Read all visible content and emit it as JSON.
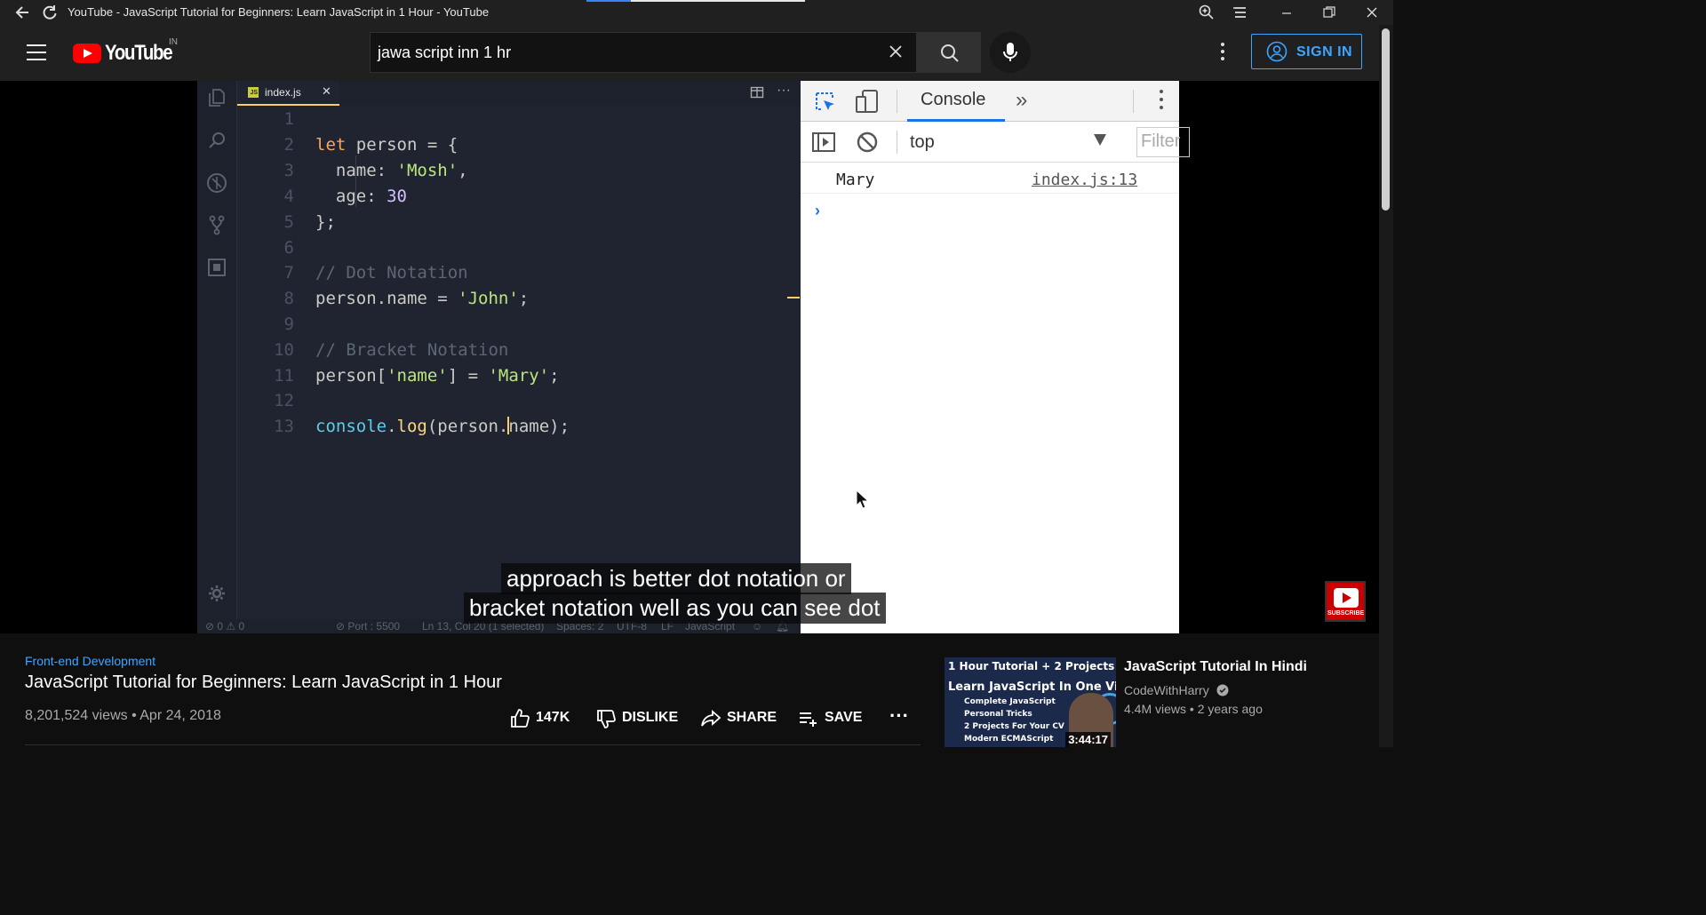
{
  "browser": {
    "page_title": "YouTube - JavaScript Tutorial for Beginners: Learn JavaScript in 1 Hour - YouTube",
    "icons": [
      "back-arrow-icon",
      "reload-icon",
      "zoom-icon",
      "menu-icon",
      "minimize-icon",
      "restore-icon",
      "close-icon"
    ]
  },
  "header": {
    "logo_text": "YouTube",
    "country_code": "IN",
    "search_value": "jawa script inn 1 hr",
    "signin_label": "SIGN IN"
  },
  "video": {
    "editor": {
      "tab_name": "index.js",
      "tab_badge": "JS",
      "line_numbers": [
        "1",
        "2",
        "3",
        "4",
        "5",
        "6",
        "7",
        "8",
        "9",
        "10",
        "11",
        "12",
        "13"
      ],
      "code": {
        "l2_kw": "let",
        "l2_rest": " person = {",
        "l3_key": "  name: ",
        "l3_val": "'Mosh'",
        "l3_end": ",",
        "l4_key": "  age: ",
        "l4_val": "30",
        "l5": "};",
        "l7": "// Dot Notation",
        "l8_a": "person.name = ",
        "l8_val": "'John'",
        "l8_end": ";",
        "l10": "// Bracket Notation",
        "l11_a": "person[",
        "l11_key": "'name'",
        "l11_b": "] = ",
        "l11_val": "'Mary'",
        "l11_end": ";",
        "l13_obj": "console",
        "l13_dot": ".",
        "l13_fn": "log",
        "l13_a": "(person.",
        "l13_b": "name);"
      },
      "status": {
        "problems": "⊘ 0 ⚠ 0",
        "port": "⊘ Port : 5500",
        "position": "Ln 13, Col 20 (1 selected)",
        "spaces": "Spaces: 2",
        "encoding": "UTF-8",
        "eol": "LF",
        "language": "JavaScript"
      }
    },
    "devtools": {
      "tab": "Console",
      "context": "top",
      "filter_placeholder": "Filter",
      "log_message": "Mary",
      "log_source": "index.js:13",
      "prompt": "›"
    },
    "captions": [
      "approach is better dot notation or",
      "bracket notation well as you can see dot"
    ],
    "subscribe_label": "SUBSCRIBE"
  },
  "info": {
    "category": "Front-end Development",
    "title": "JavaScript Tutorial for Beginners: Learn JavaScript in 1 Hour",
    "views_date": "8,201,524 views • Apr 24, 2018",
    "like_count": "147K",
    "dislike_label": "DISLIKE",
    "share_label": "SHARE",
    "save_label": "SAVE"
  },
  "recommendation": {
    "title": "JavaScript Tutorial In Hindi",
    "channel": "CodeWithHarry",
    "meta": "4.4M views • 2 years ago",
    "duration": "3:44:17",
    "thumb_lines": [
      "1 Hour Tutorial + 2 Projects",
      "Learn JavaScript In One Video",
      "Complete JavaScript",
      "Personal Tricks",
      "2 Projects For Your CV",
      "Modern ECMAScript"
    ]
  }
}
